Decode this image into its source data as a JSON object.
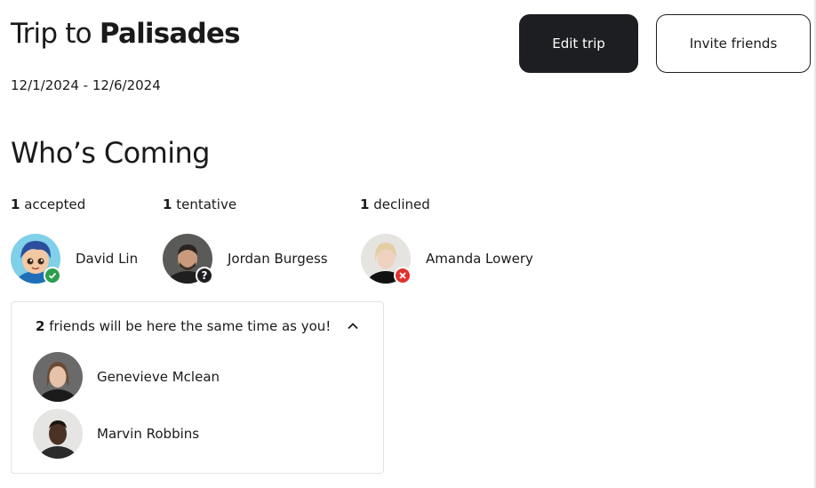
{
  "trip": {
    "title_prefix": "Trip to",
    "title_destination": "Palisades",
    "dates": "12/1/2024 - 12/6/2024"
  },
  "actions": {
    "edit_label": "Edit trip",
    "invite_label": "Invite friends"
  },
  "attendance": {
    "title": "Who’s Coming",
    "stats": [
      {
        "count": "1",
        "label": "accepted"
      },
      {
        "count": "1",
        "label": "tentative"
      },
      {
        "count": "1",
        "label": "declined"
      }
    ],
    "people": [
      {
        "name": "David Lin",
        "status": "accepted",
        "status_icon": "check-icon"
      },
      {
        "name": "Jordan Burgess",
        "status": "tentative",
        "status_icon": "question-icon"
      },
      {
        "name": "Amanda Lowery",
        "status": "declined",
        "status_icon": "x-icon"
      }
    ]
  },
  "overlap": {
    "count": "2",
    "text": "friends will be here the same time as you!",
    "toggle_icon": "chevron-up-icon",
    "friends": [
      {
        "name": "Genevieve Mclean"
      },
      {
        "name": "Marvin Robbins"
      }
    ]
  },
  "colors": {
    "primary_button": "#1d1e22",
    "accepted": "#2e9e4f",
    "declined": "#e0332f",
    "tentative": "#1d1e22"
  }
}
